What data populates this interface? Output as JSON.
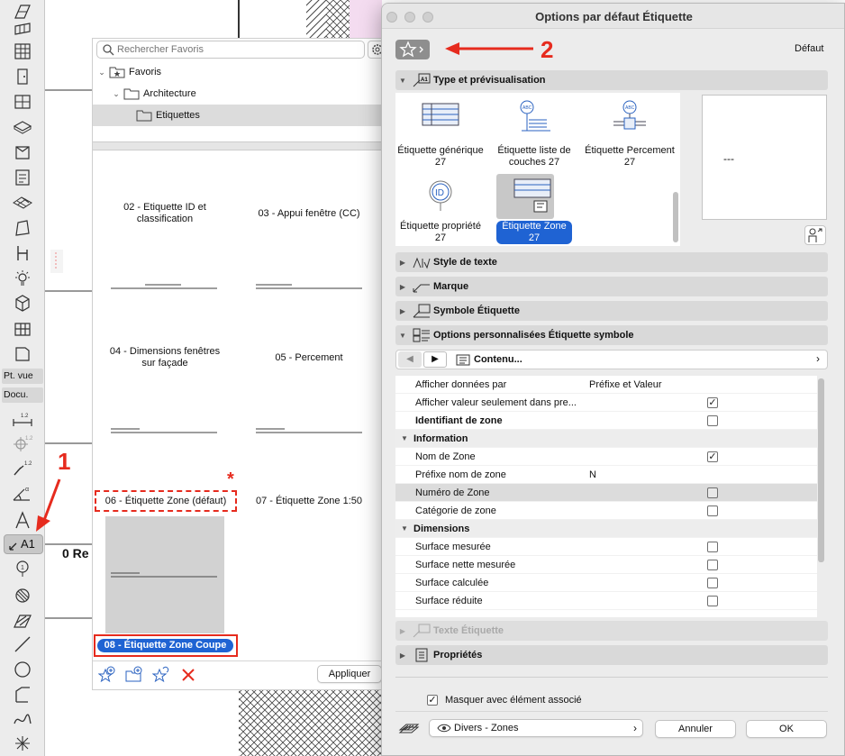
{
  "toolbox": {
    "pt_vue": "Pt. vue",
    "docu": "Docu.",
    "active_tool_label": "A1"
  },
  "background": {
    "partial_text": "0 Re"
  },
  "favorites": {
    "search_placeholder": "Rechercher Favoris",
    "tree": [
      {
        "label": "Favoris"
      },
      {
        "label": "Architecture"
      },
      {
        "label": "Etiquettes"
      }
    ],
    "items": [
      {
        "label": "02 - Etiquette ID et classification"
      },
      {
        "label": "03 - Appui fenêtre (CC)"
      },
      {
        "label": "04 - Dimensions fenêtres sur façade"
      },
      {
        "label": "05 - Percement"
      },
      {
        "label": "06 - Étiquette Zone (défaut)"
      },
      {
        "label": "07 - Étiquette Zone 1:50"
      },
      {
        "label": "08 - Étiquette Zone Coupe"
      }
    ],
    "apply_label": "Appliquer"
  },
  "annotations": {
    "step1": "1",
    "step2": "2",
    "asterisk": "*",
    "color": "#e62b1e"
  },
  "dialog": {
    "title": "Options par défaut Étiquette",
    "default_label": "Défaut",
    "sections": {
      "type": "Type et prévisualisation",
      "text_style": "Style de texte",
      "marker": "Marque",
      "symbol": "Symbole Étiquette",
      "custom": "Options personnalisées Étiquette symbole",
      "label_text": "Texte Étiquette",
      "properties": "Propriétés"
    },
    "types": [
      {
        "label": "Étiquette générique 27",
        "icon": "generic-label-icon"
      },
      {
        "label": "Étiquette liste de couches 27",
        "icon": "layer-list-label-icon"
      },
      {
        "label": "Étiquette Percement 27",
        "icon": "opening-label-icon"
      },
      {
        "label": "Étiquette propriété 27",
        "icon": "property-label-icon"
      },
      {
        "label": "Étiquette Zone 27",
        "icon": "zone-label-icon"
      }
    ],
    "preview_text": "---",
    "content_dropdown": "Contenu...",
    "params": [
      {
        "label": "Afficher données par",
        "value": "Préfixe et Valeur"
      },
      {
        "label": "Afficher valeur seulement dans pre...",
        "checked": true
      },
      {
        "label": "Identifiant de zone",
        "checked": false
      },
      {
        "group": "Information"
      },
      {
        "label": "Nom de Zone",
        "checked": true
      },
      {
        "label": "Préfixe nom de zone",
        "value": "N"
      },
      {
        "label": "Numéro de Zone",
        "checked": false
      },
      {
        "label": "Catégorie de zone",
        "checked": false
      },
      {
        "group": "Dimensions"
      },
      {
        "label": "Surface mesurée",
        "checked": false
      },
      {
        "label": "Surface nette mesurée",
        "checked": false
      },
      {
        "label": "Surface calculée",
        "checked": false
      },
      {
        "label": "Surface réduite",
        "checked": false
      }
    ],
    "hide_with_element": "Masquer avec élément associé",
    "layer_value": "Divers - Zones",
    "cancel": "Annuler",
    "ok": "OK",
    "selection_color": "#1f63d3"
  }
}
